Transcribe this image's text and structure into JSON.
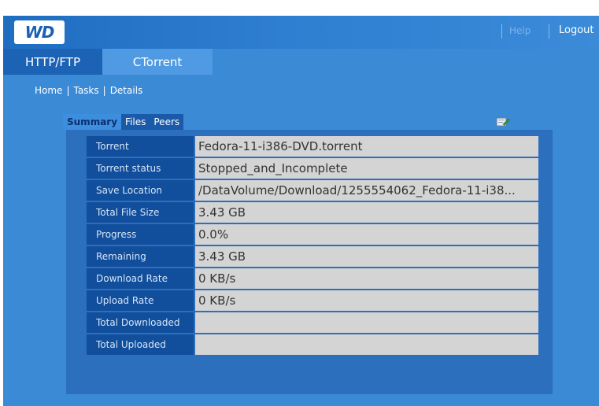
{
  "header": {
    "logo_text": "WD",
    "help_label": "Help",
    "logout_label": "Logout"
  },
  "tabs": [
    {
      "label": "HTTP/FTP"
    },
    {
      "label": "CTorrent"
    }
  ],
  "breadcrumb": [
    "Home",
    "Tasks",
    "Details"
  ],
  "subtabs": [
    {
      "label": "Summary",
      "active": true
    },
    {
      "label": "Files"
    },
    {
      "label": "Peers"
    }
  ],
  "edit_icon": "edit-icon",
  "details": [
    {
      "label": "Torrent",
      "value": "Fedora-11-i386-DVD.torrent"
    },
    {
      "label": "Torrent status",
      "value": "Stopped_and_Incomplete"
    },
    {
      "label": "Save Location",
      "value": "/DataVolume/Download/1255554062_Fedora-11-i38..."
    },
    {
      "label": "Total File Size",
      "value": "3.43 GB"
    },
    {
      "label": "Progress",
      "value": "0.0%"
    },
    {
      "label": "Remaining",
      "value": "3.43 GB"
    },
    {
      "label": "Download Rate",
      "value": "0 KB/s"
    },
    {
      "label": "Upload Rate",
      "value": "0 KB/s"
    },
    {
      "label": "Total Downloaded",
      "value": ""
    },
    {
      "label": "Total Uploaded",
      "value": ""
    }
  ],
  "colors": {
    "background": "#3a8ad6",
    "header_dark": "#1f6dc0",
    "label_cell": "#114e9c",
    "value_cell": "#d4d4d4"
  }
}
